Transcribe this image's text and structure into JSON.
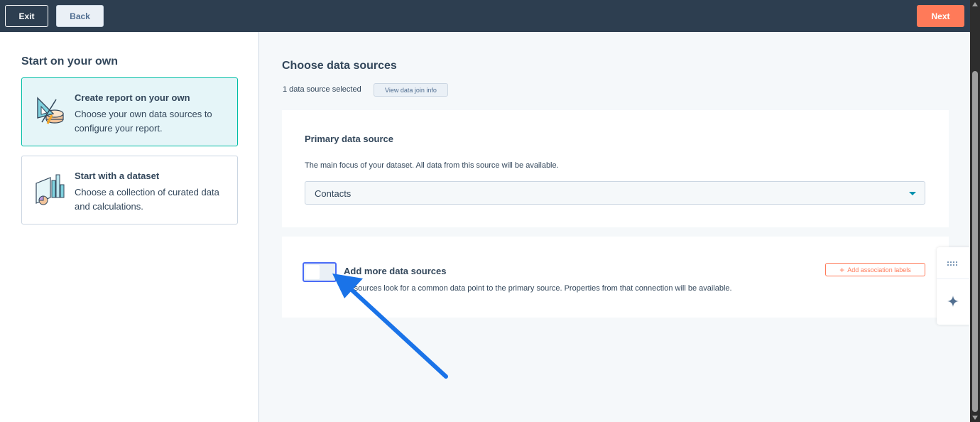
{
  "topbar": {
    "exit_label": "Exit",
    "back_label": "Back",
    "next_label": "Next"
  },
  "left": {
    "title": "Start on your own",
    "cards": [
      {
        "title": "Create report on your own",
        "description": "Choose your own data sources to configure your report.",
        "icon": "drafting-tools-icon",
        "selected": true
      },
      {
        "title": "Start with a dataset",
        "description": "Choose a collection of curated data and calculations.",
        "icon": "dataset-chart-icon",
        "selected": false
      }
    ]
  },
  "main": {
    "title": "Choose data sources",
    "selected_count_text": "1 data source selected",
    "view_join_label": "View data join info",
    "primary": {
      "title": "Primary data source",
      "description": "The main focus of your dataset. All data from this source will be available.",
      "selected_value": "Contacts"
    },
    "additional": {
      "title": "Add more data sources",
      "description": "These sources look for a common data point to the primary source. Properties from that connection will be available.",
      "visible_description": "se sources look for a common data point to the primary source. Properties from that connection will be available.",
      "toggle_on": false,
      "add_association_label": "Add association labels"
    }
  },
  "colors": {
    "topbar": "#2d3e50",
    "accent_orange": "#ff7a59",
    "selected_card_bg": "#e5f5f8",
    "selected_card_border": "#00bda5",
    "annotation_arrow": "#1a73e8",
    "toggle_focus": "#4a6cf7"
  },
  "float_tools": {
    "icons": [
      "grid-dots-icon",
      "sparkle-icon"
    ]
  }
}
